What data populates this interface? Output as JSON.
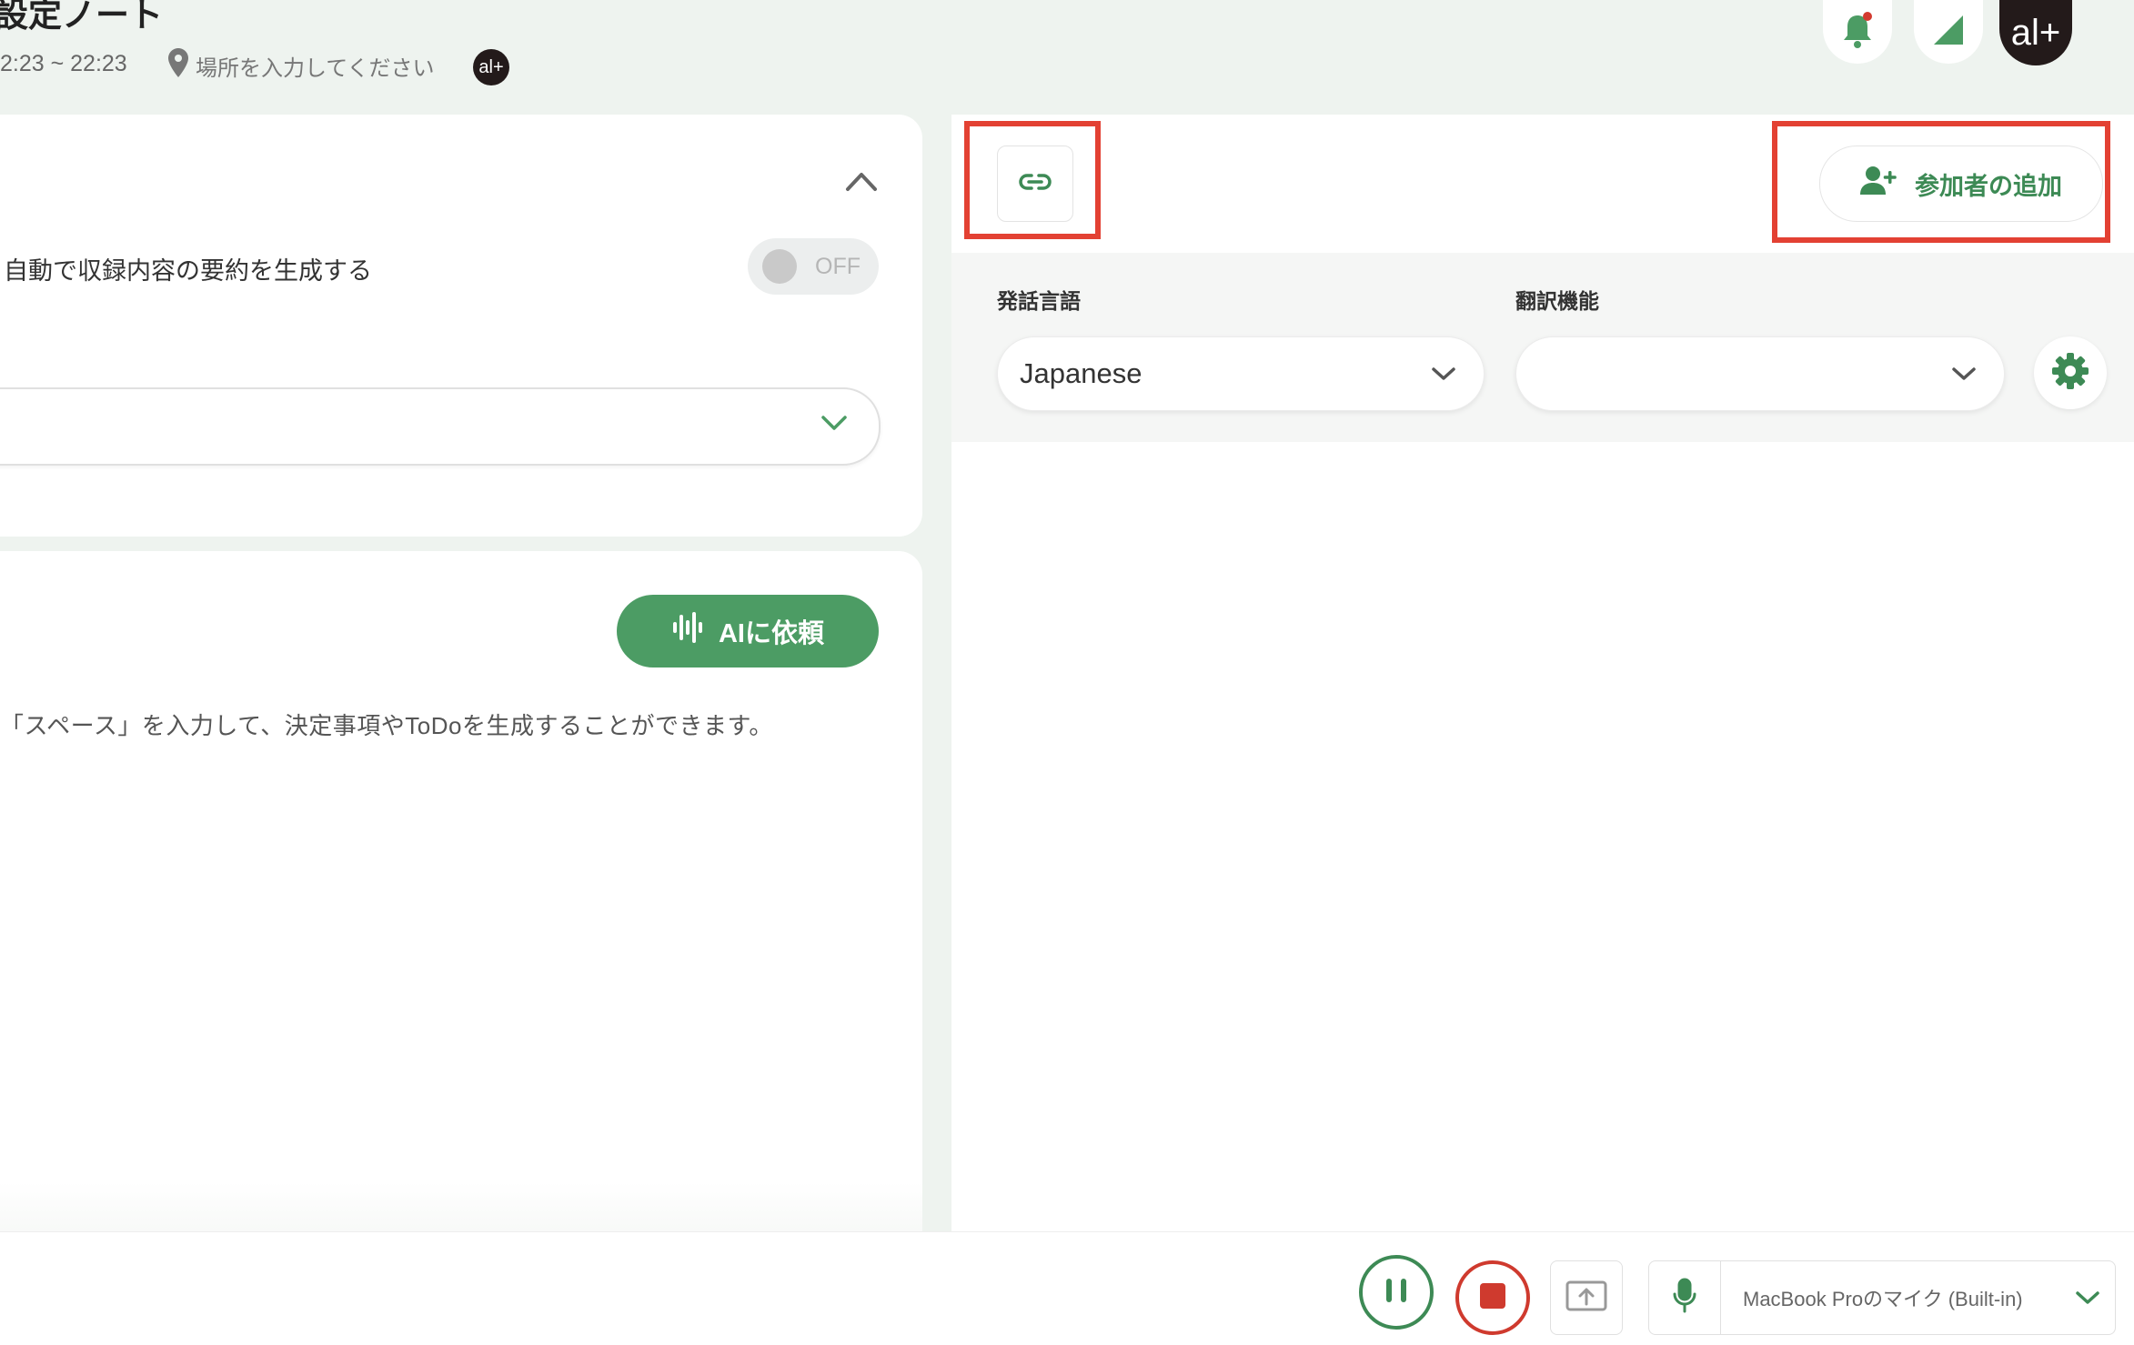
{
  "header": {
    "title": "設定ノート",
    "time_range": "2:23 ~ 22:23",
    "location_placeholder": "場所を入力してください",
    "mini_avatar_text": "al+",
    "avatar_text": "al+"
  },
  "summary": {
    "label": "自動で収録内容の要約を生成する",
    "toggle_state": "OFF"
  },
  "ai": {
    "button_label": "AIに依頼",
    "hint": "「スペース」を入力して、決定事項やToDoを生成することができます。"
  },
  "right": {
    "add_participant_label": "参加者の追加",
    "speech_language_label": "発話言語",
    "speech_language_value": "Japanese",
    "translation_label": "翻訳機能",
    "translation_value": ""
  },
  "bottom": {
    "mic_device": "MacBook Proのマイク (Built-in)"
  },
  "colors": {
    "brand_green": "#4c9c64",
    "highlight_red": "#e34133",
    "stop_red": "#cf3a2e",
    "background": "#eef3ef"
  },
  "icons": [
    "bell-icon",
    "signal-icon",
    "location-pin-icon",
    "chevron-up-icon",
    "chevron-down-icon",
    "waveform-icon",
    "link-icon",
    "add-user-icon",
    "gear-icon",
    "pause-icon",
    "stop-icon",
    "screen-share-icon",
    "mic-icon"
  ]
}
